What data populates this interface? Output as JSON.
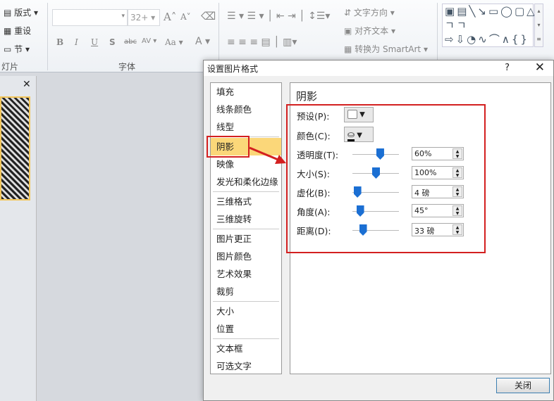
{
  "ribbon": {
    "slides_group": {
      "layout": "版式",
      "reset": "重设",
      "section": "节",
      "label": "灯片"
    },
    "font_group": {
      "font_size": "32+",
      "bold": "B",
      "italic": "I",
      "underline": "U",
      "shadow": "S",
      "strike": "abc",
      "spacing": "AV",
      "case": "Aa",
      "color": "A",
      "grow": "A",
      "shrink": "A",
      "label": "字体"
    },
    "paragraph_group": {
      "text_direction": "文字方向",
      "align_text": "对齐文本",
      "convert_smartart": "转换为 SmartArt"
    },
    "shapes": [
      "▣",
      "▤",
      "╲",
      "↘",
      "▭",
      "◯",
      "▢",
      "△",
      "ㄱ",
      "ㄱ",
      "⇨",
      "⇩",
      "◔",
      "∿",
      "⌒",
      "∧",
      "{",
      "}"
    ]
  },
  "dialog": {
    "title": "设置图片格式",
    "help": "?",
    "close_x": "✕",
    "nav": [
      "填充",
      "线条颜色",
      "线型",
      "阴影",
      "映像",
      "发光和柔化边缘",
      "三维格式",
      "三维旋转",
      "图片更正",
      "图片颜色",
      "艺术效果",
      "裁剪",
      "大小",
      "位置",
      "文本框",
      "可选文字"
    ],
    "selected_nav": "阴影",
    "section_title": "阴影",
    "preset_label": "预设(P):",
    "color_label": "颜色(C):",
    "sliders": [
      {
        "label": "透明度(T):",
        "value": "60%",
        "fraction": 0.59
      },
      {
        "label": "大小(S):",
        "value": "100%",
        "fraction": 0.5
      },
      {
        "label": "虚化(B):",
        "value": "4 磅",
        "fraction": 0.1
      },
      {
        "label": "角度(A):",
        "value": "45°",
        "fraction": 0.16
      },
      {
        "label": "距离(D):",
        "value": "33 磅",
        "fraction": 0.22
      }
    ],
    "close_button": "关闭"
  },
  "colors": {
    "highlight": "#fbd779",
    "annotation": "#d32020",
    "slider": "#1b6fd3"
  }
}
